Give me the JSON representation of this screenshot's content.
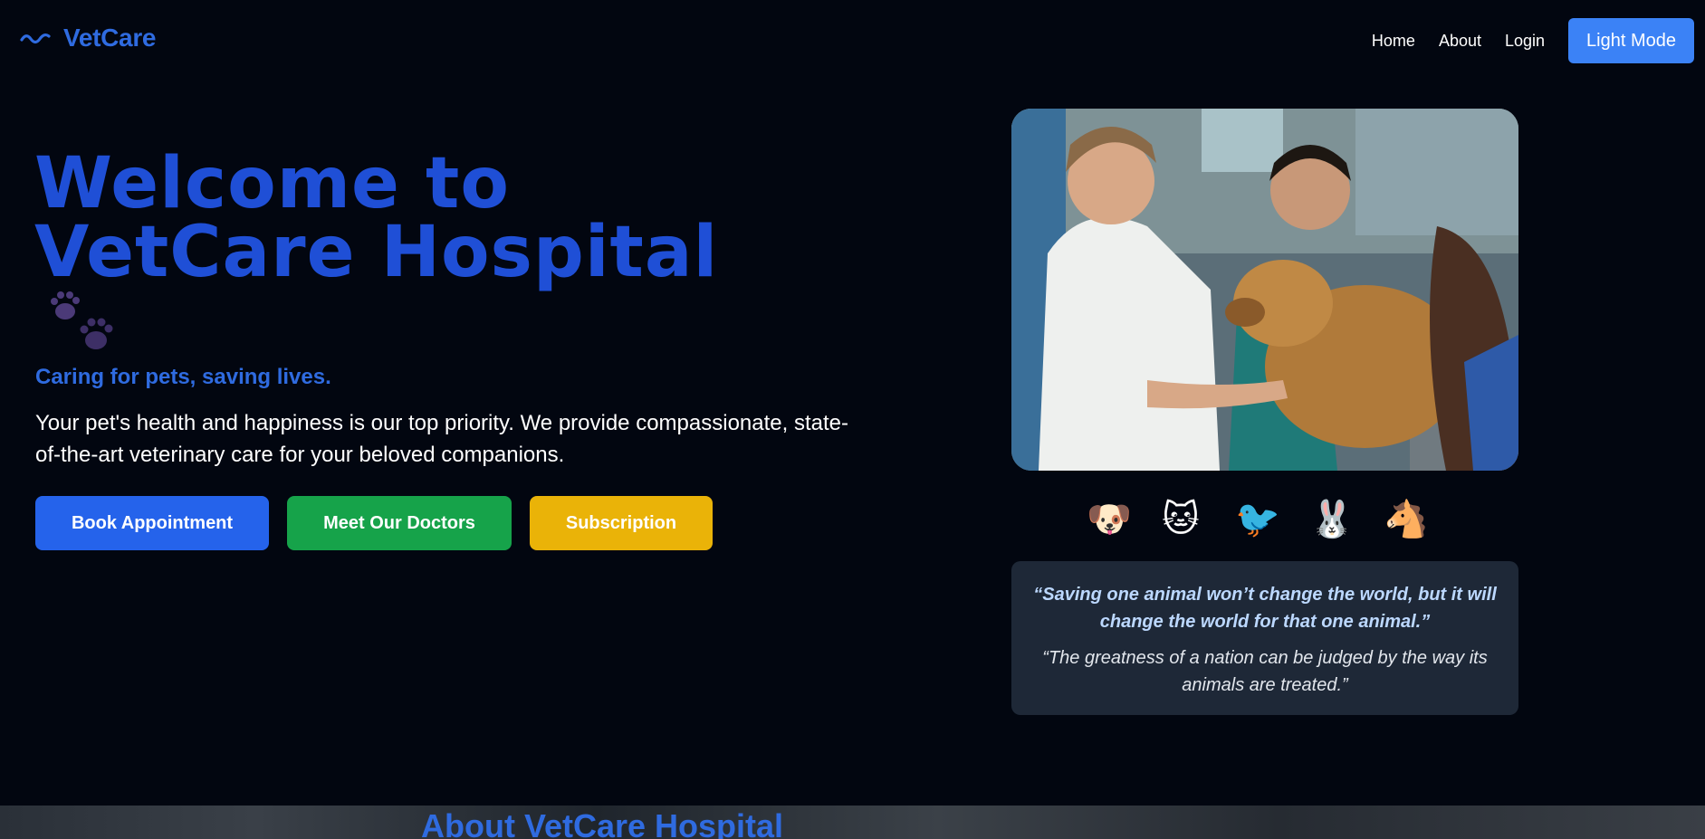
{
  "nav": {
    "brand": "VetCare",
    "links": [
      "Home",
      "About",
      "Login"
    ],
    "mode_button": "Light Mode"
  },
  "hero": {
    "title": "Welcome to VetCare Hospital",
    "tagline": "Caring for pets, saving lives.",
    "description": "Your pet's health and happiness is our top priority. We provide compassionate, state-of-the-art veterinary care for your beloved companions.",
    "buttons": {
      "book": "Book Appointment",
      "doctors": "Meet Our Doctors",
      "subscription": "Subscription"
    }
  },
  "animals": [
    "🐶",
    "🐱",
    "🐦",
    "🐰",
    "🐴"
  ],
  "quotes": {
    "primary": "“Saving one animal won’t change the world, but it will change the world for that one animal.”",
    "secondary": "“The greatness of a nation can be judged by the way its animals are treated.”"
  },
  "about": {
    "title": "About VetCare Hospital"
  },
  "colors": {
    "background": "#020610",
    "brand_blue": "#1f4fd6",
    "accent_blue": "#3b82f6",
    "green": "#16a34a",
    "yellow": "#eab308",
    "quote_box": "#1e2837"
  },
  "icons": {
    "brand": "wave-icon",
    "paw": "paw-prints-icon"
  }
}
